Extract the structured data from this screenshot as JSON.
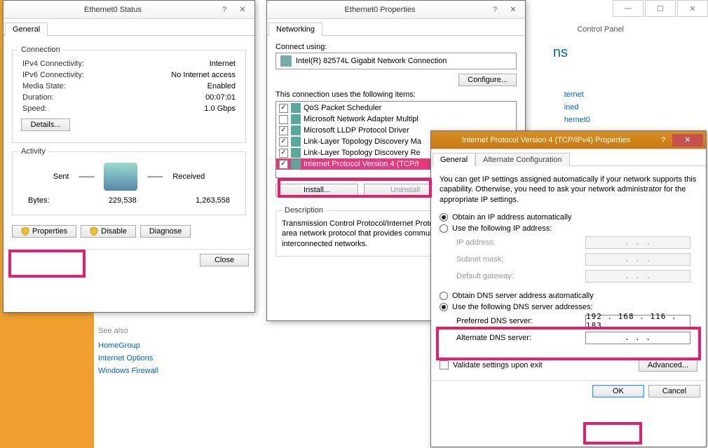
{
  "background": {
    "control_panel": "Control Panel",
    "ns": "ns",
    "net_links": [
      "ternet",
      "ined",
      "hernet0"
    ]
  },
  "status_window": {
    "title": "Ethernet0 Status",
    "tab_general": "General",
    "group_connection": "Connection",
    "ipv4_label": "IPv4 Connectivity:",
    "ipv4_value": "Internet",
    "ipv6_label": "IPv6 Connectivity:",
    "ipv6_value": "No Internet access",
    "media_label": "Media State:",
    "media_value": "Enabled",
    "duration_label": "Duration:",
    "duration_value": "00:07:01",
    "speed_label": "Speed:",
    "speed_value": "1.0 Gbps",
    "details_btn": "Details...",
    "group_activity": "Activity",
    "sent": "Sent",
    "received": "Received",
    "bytes_label": "Bytes:",
    "bytes_sent": "229,538",
    "bytes_recv": "1,263,558",
    "properties_btn": "Properties",
    "disable_btn": "Disable",
    "diagnose_btn": "Diagnose",
    "close_btn": "Close"
  },
  "props_window": {
    "title": "Ethernet0 Properties",
    "tab_networking": "Networking",
    "connect_using": "Connect using:",
    "adapter": "Intel(R) 82574L Gigabit Network Connection",
    "configure_btn": "Configure...",
    "items_label": "This connection uses the following items:",
    "items": [
      {
        "checked": true,
        "label": "QoS Packet Scheduler"
      },
      {
        "checked": false,
        "label": "Microsoft Network Adapter Multipl"
      },
      {
        "checked": true,
        "label": "Microsoft LLDP Protocol Driver"
      },
      {
        "checked": true,
        "label": "Link-Layer Topology Discovery Ma"
      },
      {
        "checked": true,
        "label": "Link-Layer Topology Discovery Re"
      },
      {
        "checked": true,
        "label": "Internet Protocol Version 4 (TCP/I",
        "hl": true
      }
    ],
    "install_btn": "Install...",
    "uninstall_btn": "Uninstall",
    "desc_group": "Description",
    "desc_text": "Transmission Control Protocol/Internet Protocol. The default wide area network protocol that provides communication across diverse interconnected networks."
  },
  "ipv4_window": {
    "title": "Internet Protocol Version 4 (TCP/IPv4) Properties",
    "tab_general": "General",
    "tab_alt": "Alternate Configuration",
    "blurb": "You can get IP settings assigned automatically if your network supports this capability. Otherwise, you need to ask your network administrator for the appropriate IP settings.",
    "ip_auto": "Obtain an IP address automatically",
    "ip_manual": "Use the following IP address:",
    "ip_addr_l": "IP address:",
    "subnet_l": "Subnet mask:",
    "gateway_l": "Default gateway:",
    "dns_auto": "Obtain DNS server address automatically",
    "dns_manual": "Use the following DNS server addresses:",
    "pref_dns_l": "Preferred DNS server:",
    "pref_dns_v": "192 . 168 . 116 . 183",
    "alt_dns_l": "Alternate DNS server:",
    "alt_dns_v": ".       .       .",
    "validate": "Validate settings upon exit",
    "advanced_btn": "Advanced...",
    "ok_btn": "OK",
    "cancel_btn": "Cancel"
  },
  "seealso": {
    "hdr": "See also",
    "links": [
      "HomeGroup",
      "Internet Options",
      "Windows Firewall"
    ]
  },
  "dots": ".       .       ."
}
